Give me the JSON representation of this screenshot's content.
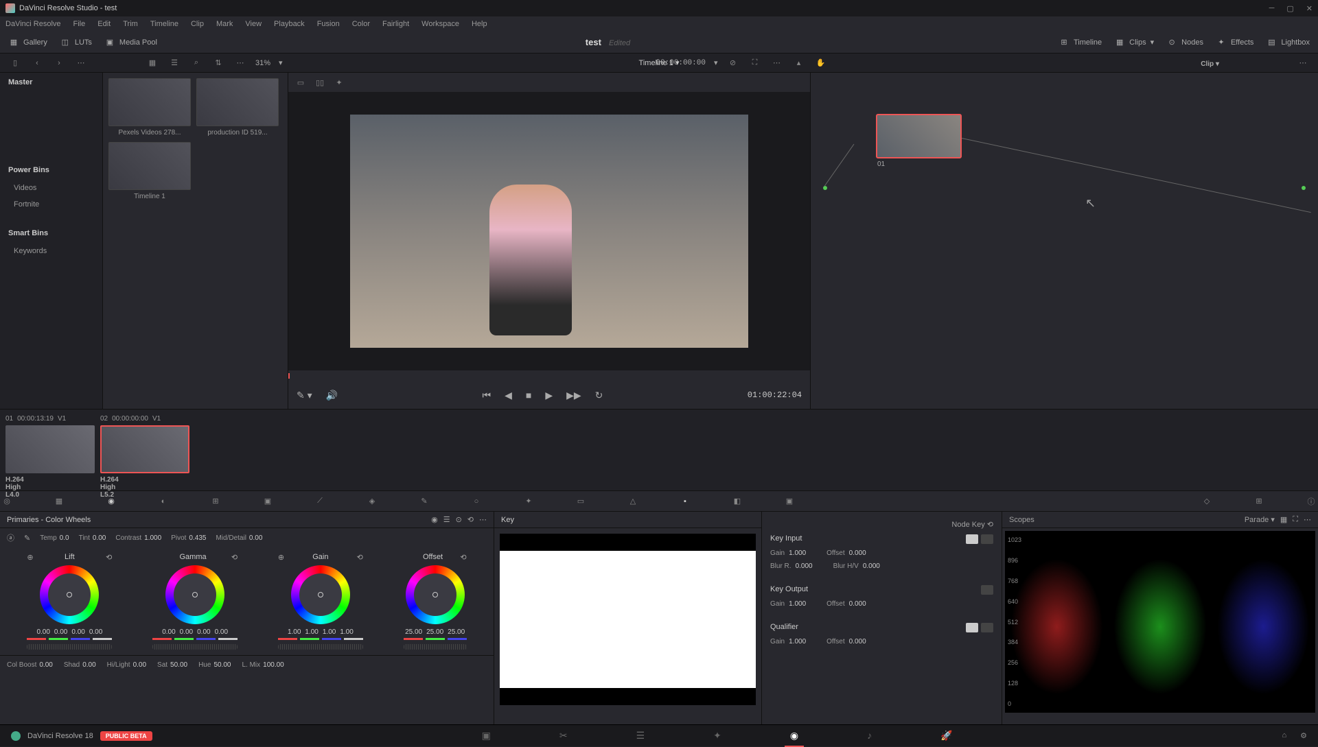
{
  "titlebar": {
    "text": "DaVinci Resolve Studio - test"
  },
  "menubar": [
    "DaVinci Resolve",
    "File",
    "Edit",
    "Trim",
    "Timeline",
    "Clip",
    "Mark",
    "View",
    "Playback",
    "Fusion",
    "Color",
    "Fairlight",
    "Workspace",
    "Help"
  ],
  "toolbar": {
    "left": {
      "gallery": "Gallery",
      "luts": "LUTs",
      "mediapool": "Media Pool"
    },
    "center": {
      "project": "test",
      "status": "Edited"
    },
    "right": {
      "timeline": "Timeline",
      "clips": "Clips",
      "nodes": "Nodes",
      "effects": "Effects",
      "lightbox": "Lightbox"
    }
  },
  "sec_toolbar": {
    "zoom": "31%",
    "timeline_name": "Timeline 1",
    "timecode": "00:00:00:00",
    "clip_mode": "Clip"
  },
  "left_panel": {
    "master": "Master",
    "powerbins": {
      "header": "Power Bins",
      "items": [
        "Videos",
        "Fortnite"
      ]
    },
    "smartbins": {
      "header": "Smart Bins",
      "items": [
        "Keywords"
      ]
    }
  },
  "media_pool": {
    "items": [
      {
        "label": "Pexels Videos 278..."
      },
      {
        "label": "production ID 519..."
      },
      {
        "label": "Timeline 1"
      }
    ]
  },
  "viewer": {
    "timecode": "01:00:22:04"
  },
  "node": {
    "label": "01"
  },
  "clips": [
    {
      "index": "01",
      "tc": "00:00:13:19",
      "track": "V1",
      "codec": "H.264 High L4.0",
      "selected": false
    },
    {
      "index": "02",
      "tc": "00:00:00:00",
      "track": "V1",
      "codec": "H.264 High L5.2",
      "selected": true
    }
  ],
  "primaries": {
    "title": "Primaries - Color Wheels",
    "top_params": {
      "temp": {
        "label": "Temp",
        "value": "0.0"
      },
      "tint": {
        "label": "Tint",
        "value": "0.00"
      },
      "contrast": {
        "label": "Contrast",
        "value": "1.000"
      },
      "pivot": {
        "label": "Pivot",
        "value": "0.435"
      },
      "middetail": {
        "label": "Mid/Detail",
        "value": "0.00"
      }
    },
    "wheels": [
      {
        "name": "Lift",
        "values": [
          "0.00",
          "0.00",
          "0.00",
          "0.00"
        ]
      },
      {
        "name": "Gamma",
        "values": [
          "0.00",
          "0.00",
          "0.00",
          "0.00"
        ]
      },
      {
        "name": "Gain",
        "values": [
          "1.00",
          "1.00",
          "1.00",
          "1.00"
        ]
      },
      {
        "name": "Offset",
        "values": [
          "25.00",
          "25.00",
          "25.00"
        ]
      }
    ],
    "bottom_params": {
      "colboost": {
        "label": "Col Boost",
        "value": "0.00"
      },
      "shad": {
        "label": "Shad",
        "value": "0.00"
      },
      "hilight": {
        "label": "Hi/Light",
        "value": "0.00"
      },
      "sat": {
        "label": "Sat",
        "value": "50.00"
      },
      "hue": {
        "label": "Hue",
        "value": "50.00"
      },
      "lmix": {
        "label": "L. Mix",
        "value": "100.00"
      }
    }
  },
  "key_panel": {
    "title": "Key",
    "node_key": "Node Key",
    "input": {
      "header": "Key Input",
      "gain": {
        "label": "Gain",
        "value": "1.000"
      },
      "offset": {
        "label": "Offset",
        "value": "0.000"
      },
      "blur_r": {
        "label": "Blur R.",
        "value": "0.000"
      },
      "blur_hv": {
        "label": "Blur H/V",
        "value": "0.000"
      }
    },
    "output": {
      "header": "Key Output",
      "gain": {
        "label": "Gain",
        "value": "1.000"
      },
      "offset": {
        "label": "Offset",
        "value": "0.000"
      }
    },
    "qualifier": {
      "header": "Qualifier",
      "gain": {
        "label": "Gain",
        "value": "1.000"
      },
      "offset": {
        "label": "Offset",
        "value": "0.000"
      }
    }
  },
  "scopes": {
    "title": "Scopes",
    "mode": "Parade",
    "scale": [
      "1023",
      "896",
      "768",
      "640",
      "512",
      "384",
      "256",
      "128",
      "0"
    ]
  },
  "bottom_nav": {
    "version": "DaVinci Resolve 18",
    "badge": "PUBLIC BETA"
  }
}
